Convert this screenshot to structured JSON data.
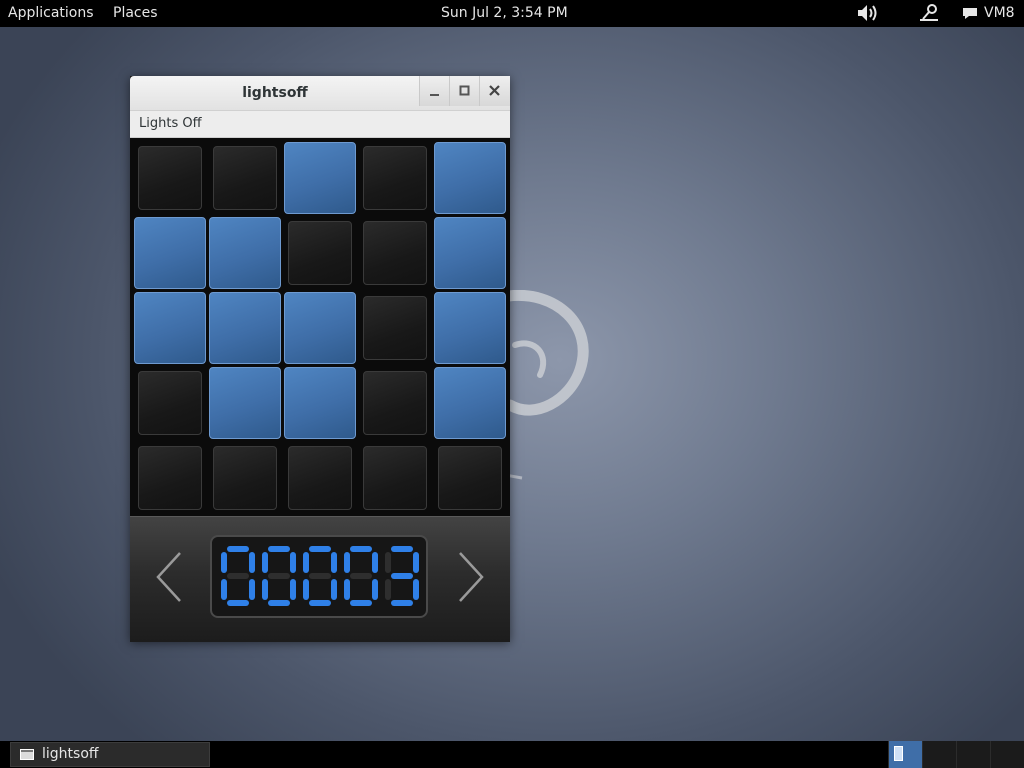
{
  "top_panel": {
    "applications": "Applications",
    "places": "Places",
    "clock": "Sun Jul  2,  3:54 PM",
    "user": "VM8"
  },
  "window": {
    "title": "lightsoff",
    "menu": "Lights Off"
  },
  "board": {
    "rows": [
      [
        false,
        false,
        true,
        false,
        true
      ],
      [
        true,
        true,
        false,
        false,
        true
      ],
      [
        true,
        true,
        true,
        false,
        true
      ],
      [
        false,
        true,
        true,
        false,
        true
      ],
      [
        false,
        false,
        false,
        false,
        false
      ]
    ]
  },
  "level": {
    "digits": "00003",
    "color": "#2f80e8"
  },
  "taskbar": {
    "task_label": "lightsoff"
  },
  "colors": {
    "light_on": "#4f85c2",
    "light_off": "#1b1b1b",
    "workspace_active": "#3f6ea8"
  }
}
